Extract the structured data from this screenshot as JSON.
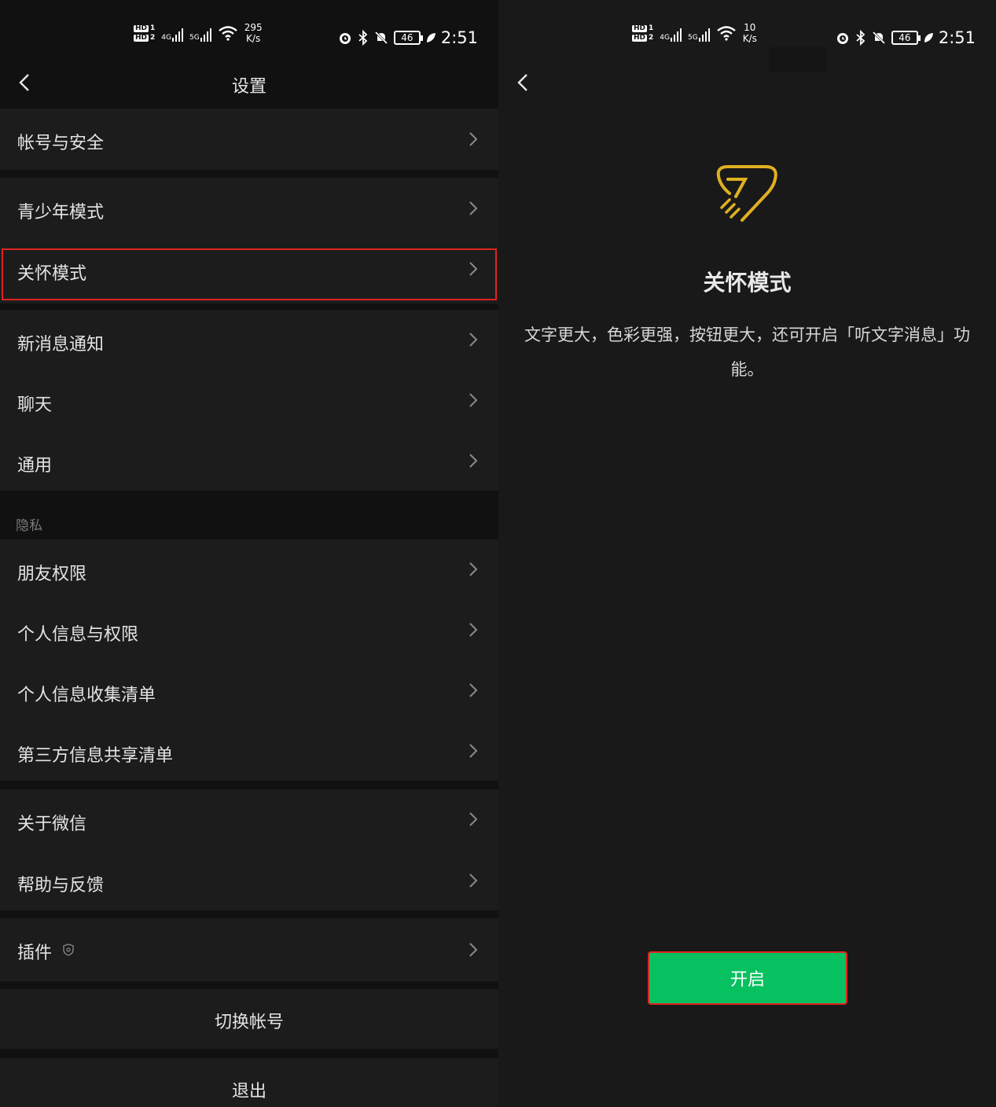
{
  "status_left": {
    "hd1": "HD",
    "sim1": "1",
    "hd2": "HD",
    "sim2": "2",
    "net1": "4G",
    "net2": "5G",
    "speed_value": "295",
    "speed_unit": "K/s",
    "battery": "46",
    "time": "2:51"
  },
  "status_right": {
    "hd1": "HD",
    "sim1": "1",
    "hd2": "HD",
    "sim2": "2",
    "net1": "4G",
    "net2": "5G",
    "speed_value": "10",
    "speed_unit": "K/s",
    "battery": "46",
    "time": "2:51"
  },
  "settings": {
    "title": "设置",
    "items": [
      {
        "label": "帐号与安全"
      },
      {
        "label": "青少年模式"
      },
      {
        "label": "关怀模式"
      },
      {
        "label": "新消息通知"
      },
      {
        "label": "聊天"
      },
      {
        "label": "通用"
      },
      {
        "label": "朋友权限"
      },
      {
        "label": "个人信息与权限"
      },
      {
        "label": "个人信息收集清单"
      },
      {
        "label": "第三方信息共享清单"
      },
      {
        "label": "关于微信"
      },
      {
        "label": "帮助与反馈"
      },
      {
        "label": "插件"
      }
    ],
    "privacy_section": "隐私",
    "switch_account": "切换帐号",
    "logout": "退出"
  },
  "care_mode": {
    "title": "关怀模式",
    "description": "文字更大，色彩更强，按钮更大，还可开启「听文字消息」功能。",
    "button": "开启"
  },
  "colors": {
    "accent_green": "#07c160",
    "highlight_red": "#e0241f",
    "icon_gold": "#e0b020"
  }
}
